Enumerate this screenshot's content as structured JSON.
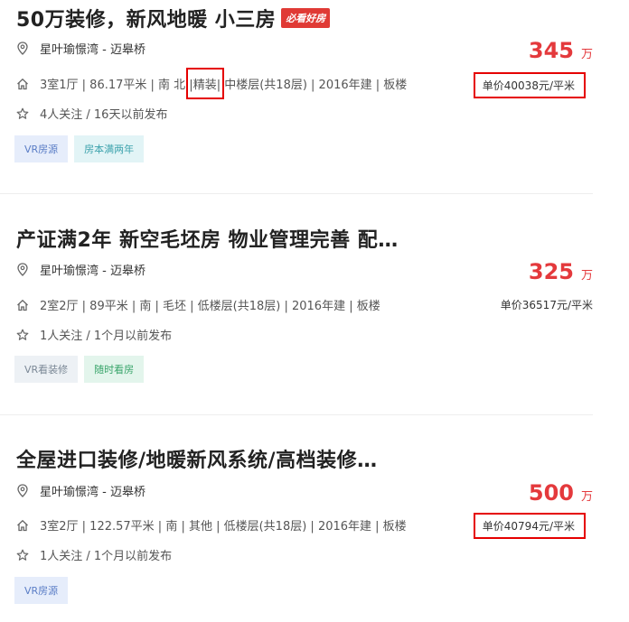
{
  "listings": [
    {
      "title": "50万装修，新风地暖 小三房",
      "badge": "必看好房",
      "community": "星叶瑜憬湾 - 迈皋桥",
      "meta_before": "3室1厅 | 86.17平米 | 南 北 | ",
      "meta_highlight": "精装",
      "meta_after": " | 中楼层(共18层) | 2016年建 | 板楼",
      "follow": "4人关注 / 16天以前发布",
      "price": "345",
      "price_unit": "万",
      "unit_price": "单价40038元/平米",
      "tags": [
        {
          "label": "VR房源"
        },
        {
          "label": "房本满两年"
        }
      ]
    },
    {
      "title": "产证满2年 新空毛坯房 物业管理完善 配…",
      "community": "星叶瑜憬湾 - 迈皋桥",
      "meta": "2室2厅 | 89平米 | 南 | 毛坯 | 低楼层(共18层) | 2016年建 | 板楼",
      "follow": "1人关注 / 1个月以前发布",
      "price": "325",
      "price_unit": "万",
      "unit_price": "单价36517元/平米",
      "tags": [
        {
          "label": "VR看装修"
        },
        {
          "label": "随时看房"
        }
      ]
    },
    {
      "title": "全屋进口装修/地暖新风系统/高档装修…",
      "community": "星叶瑜憬湾 - 迈皋桥",
      "meta": "3室2厅 | 122.57平米 | 南 | 其他 | 低楼层(共18层) | 2016年建 | 板楼",
      "follow": "1人关注 / 1个月以前发布",
      "price": "500",
      "price_unit": "万",
      "unit_price": "单价40794元/平米",
      "tags": [
        {
          "label": "VR房源"
        }
      ]
    }
  ],
  "colors": {
    "price": "#e4393c",
    "badge": "#e03a35",
    "highlight_box": "#e50000"
  },
  "icons": [
    "location-pin-icon",
    "house-icon",
    "star-icon"
  ]
}
